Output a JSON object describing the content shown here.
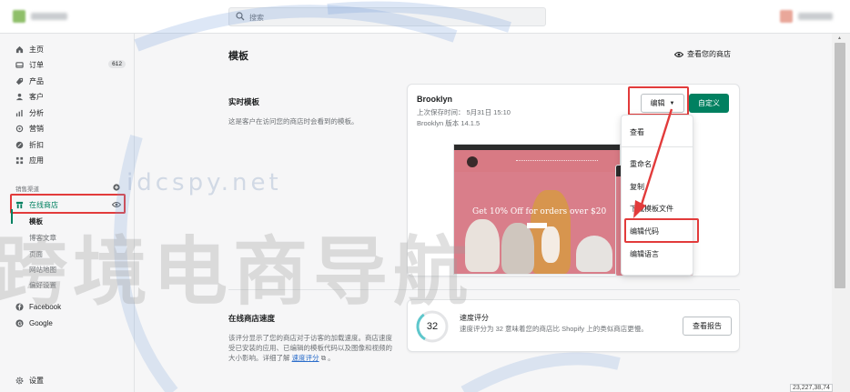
{
  "search": {
    "placeholder": "搜索"
  },
  "sidebar": {
    "items": [
      {
        "label": "主页",
        "icon": "home-icon"
      },
      {
        "label": "订单",
        "icon": "orders-icon",
        "badge": "612"
      },
      {
        "label": "产品",
        "icon": "tag-icon"
      },
      {
        "label": "客户",
        "icon": "customer-icon"
      },
      {
        "label": "分析",
        "icon": "analytics-icon"
      },
      {
        "label": "营销",
        "icon": "marketing-icon"
      },
      {
        "label": "折扣",
        "icon": "discount-icon"
      },
      {
        "label": "应用",
        "icon": "apps-icon"
      }
    ],
    "channels_label": "销售渠道",
    "online_store": "在线商店",
    "sub_items": [
      "模板",
      "博客文章",
      "页面",
      "网站地图",
      "偏好设置"
    ],
    "facebook": "Facebook",
    "google": "Google",
    "settings": "设置"
  },
  "main": {
    "title": "模板",
    "view_store": "查看您的商店",
    "live_theme": {
      "heading": "实时模板",
      "desc": "这是客户在访问您的商店时会看到的模板。"
    },
    "theme_card": {
      "name": "Brooklyn",
      "last_saved": "上次保存时间： 5月31日 15:10",
      "version": "Brooklyn 版本 14.1.5",
      "edit_label": "编辑",
      "customize_label": "自定义",
      "preview_hero_text": "Get 10% Off for orders over $20"
    },
    "dropdown": {
      "items": [
        "查看",
        "重命名",
        "复制",
        "下载模板文件",
        "编辑代码",
        "编辑语言"
      ]
    },
    "speed": {
      "heading": "在线商店速度",
      "desc": "该评分显示了您的商店对于访客的加载速度。商店速度受已安装的应用、已编辑的模板代码以及图像和视频的大小影响。详细了解",
      "link": "速度评分",
      "score": "32",
      "card_title": "速度评分",
      "card_desc": "速度评分为 32 意味着您的商店比 Shopify 上的类似商店更慢。",
      "report_btn": "查看报告"
    }
  },
  "status": {
    "coords": "23,227,38,74"
  },
  "watermark": {
    "url": "idcspy.net",
    "text": "跨境电商导航"
  },
  "colors": {
    "primary": "#008060",
    "highlight": "#e23b3b",
    "link": "#2c6ecb"
  }
}
